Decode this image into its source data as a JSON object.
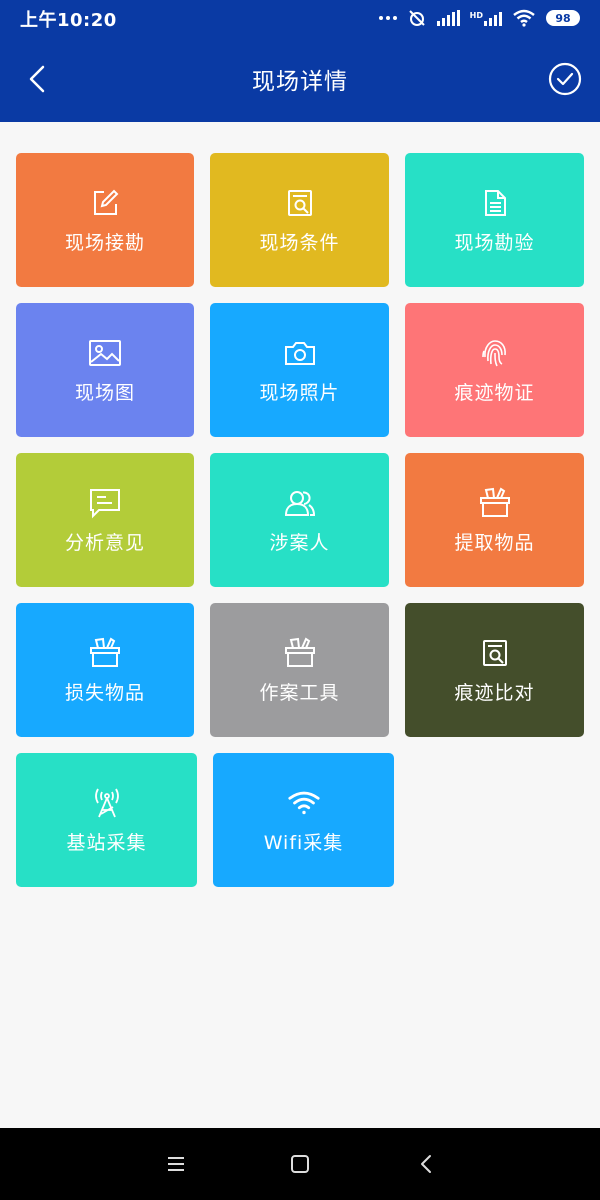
{
  "status": {
    "time": "上午10:20",
    "battery": "98"
  },
  "nav": {
    "title": "现场详情"
  },
  "tiles": [
    {
      "label": "现场接勘",
      "color": "#f27a41",
      "icon": "edit-icon"
    },
    {
      "label": "现场条件",
      "color": "#e1b920",
      "icon": "search-document-icon"
    },
    {
      "label": "现场勘验",
      "color": "#27e0c6",
      "icon": "document-icon"
    },
    {
      "label": "现场图",
      "color": "#6b83ef",
      "icon": "image-icon"
    },
    {
      "label": "现场照片",
      "color": "#17a9ff",
      "icon": "camera-icon"
    },
    {
      "label": "痕迹物证",
      "color": "#fe7577",
      "icon": "fingerprint-icon"
    },
    {
      "label": "分析意见",
      "color": "#b3cc39",
      "icon": "message-icon"
    },
    {
      "label": "涉案人",
      "color": "#27e0c6",
      "icon": "people-icon"
    },
    {
      "label": "提取物品",
      "color": "#f27a41",
      "icon": "box-icon"
    },
    {
      "label": "损失物品",
      "color": "#17a9ff",
      "icon": "box-icon"
    },
    {
      "label": "作案工具",
      "color": "#9c9c9e",
      "icon": "box-icon"
    },
    {
      "label": "痕迹比对",
      "color": "#444e2b",
      "icon": "search-document-icon"
    },
    {
      "label": "基站采集",
      "color": "#27e0c6",
      "icon": "antenna-icon"
    },
    {
      "label": "Wifi采集",
      "color": "#17a9ff",
      "icon": "wifi-icon"
    }
  ]
}
